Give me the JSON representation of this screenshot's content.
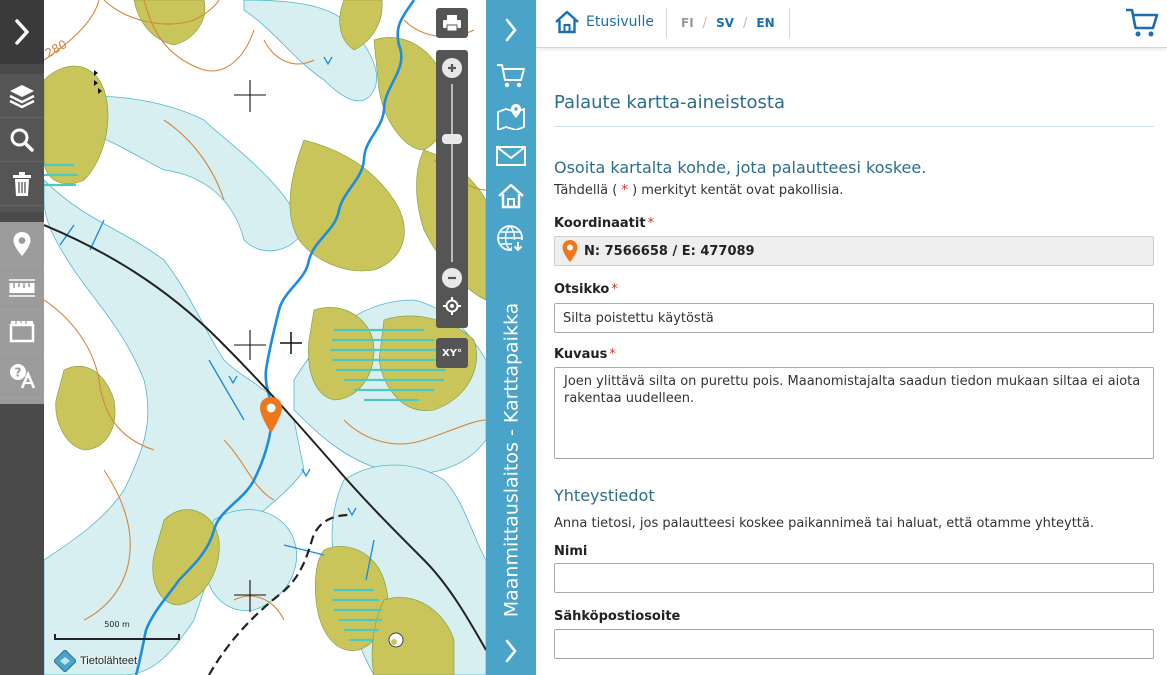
{
  "left_toolbar": {
    "expand_icon": "chevron-right-icon",
    "tools": [
      "layers-icon",
      "search-icon",
      "trash-icon",
      "map-marker-icon",
      "ruler-icon",
      "measure-area-icon",
      "help-icon"
    ]
  },
  "map": {
    "scale_label": "500 m",
    "attribution_label": "Tietolähteet",
    "contour_label": "280",
    "controls": {
      "print_icon": "printer-icon",
      "zoom_in_icon": "plus-icon",
      "zoom_out_icon": "minus-icon",
      "locate_icon": "crosshair-icon",
      "xy_label": "XY°"
    },
    "colors": {
      "water": "#d7eff0",
      "river": "#1e8ce0",
      "forest": "#c9c55a",
      "contour": "#d4863c",
      "marker": "#f0761b"
    }
  },
  "side_tabs": {
    "title": "Maanmittauslaitos - Karttapaikka",
    "icons": [
      "chevron-right-icon",
      "cart-icon",
      "map-pin-icon",
      "mail-icon",
      "home-icon",
      "globe-download-icon",
      "chevron-right-icon"
    ],
    "color": "#4aa3c9"
  },
  "panel": {
    "home_label": "Etusivulle",
    "languages": [
      "FI",
      "SV",
      "EN"
    ],
    "active_language": "FI",
    "heading": "Palaute kartta-aineistosta",
    "section_title": "Osoita kartalta kohde, jota palautteesi koskee.",
    "required_note_prefix": "Tähdellä (",
    "required_star": "*",
    "required_note_suffix": ") merkityt kentät ovat pakollisia.",
    "coordinates": {
      "label": "Koordinaatit",
      "value": "N: 7566658 / E: 477089"
    },
    "title_field": {
      "label": "Otsikko",
      "value": "Silta poistettu käytöstä"
    },
    "description_field": {
      "label": "Kuvaus",
      "value": "Joen ylittävä silta on purettu pois. Maanomistajalta saadun tiedon mukaan siltaa ei aiota rakentaa uudelleen."
    },
    "contact": {
      "title": "Yhteystiedot",
      "note": "Anna tietosi, jos palautteesi koskee paikannimeä tai haluat, että otamme yhteyttä.",
      "name_label": "Nimi",
      "name_value": "",
      "email_label": "Sähköpostiosoite",
      "email_value": ""
    }
  }
}
